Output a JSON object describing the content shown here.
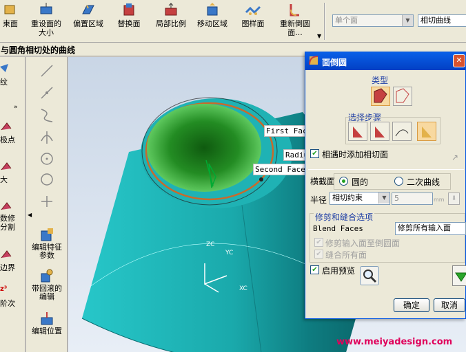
{
  "toolbar": {
    "buttons": [
      {
        "label": "束面",
        "icon": "shell-face-icon"
      },
      {
        "label": "重设面的\n大小",
        "icon": "resize-face-icon"
      },
      {
        "label": "偏置区域",
        "icon": "offset-region-icon"
      },
      {
        "label": "替换面",
        "icon": "replace-face-icon"
      },
      {
        "label": "局部比例",
        "icon": "local-scale-icon"
      },
      {
        "label": "移动区域",
        "icon": "move-region-icon"
      },
      {
        "label": "图样面",
        "icon": "pattern-face-icon"
      },
      {
        "label": "重新倒圆\n面...",
        "icon": "reblend-face-icon"
      }
    ],
    "combo_left": "单个面",
    "combo_right": "相切曲线"
  },
  "strip_title": "与圆角相切处的曲线",
  "left_panel": {
    "items": [
      "纹",
      "极点",
      "大",
      "数修\n分割",
      "边界",
      "阶次"
    ]
  },
  "edit_column": {
    "items": [
      "编辑特征\n参数",
      "带回滚的\n编辑",
      "编辑位置"
    ]
  },
  "viewport": {
    "labels": {
      "first_face": "First Face",
      "radius": "Radiu",
      "second_face": "Second Face"
    },
    "axes": {
      "zc": "ZC",
      "yc": "YC",
      "xc": "XC"
    },
    "colors": {
      "cone": "#1fb2b4",
      "inner": "#2c9f2c",
      "edge": "#c96a2b"
    }
  },
  "dialog": {
    "title": "面倒圆",
    "type_label": "类型",
    "steps_label": "选择步骤",
    "add_tangent_faces": "相遇时添加相切面",
    "add_tangent_checked": true,
    "cross_section_label": "横截面",
    "radio_circular": "圆的",
    "radio_conic": "二次曲线",
    "radius_label": "半径",
    "radius_mode": "相切约束",
    "radius_value": "5",
    "radius_unit": "mm",
    "trim_group": "修剪和缝合选项",
    "blend_faces_label": "Blend Faces",
    "blend_faces_value": "修剪所有输入面",
    "trim_to_blend": "修剪输入面至倒圆面",
    "sew_all": "缝合所有面",
    "enable_preview": "启用预览",
    "enable_preview_checked": true,
    "ok": "确定",
    "cancel": "取消"
  },
  "watermark": "www.meiyadesign.com"
}
